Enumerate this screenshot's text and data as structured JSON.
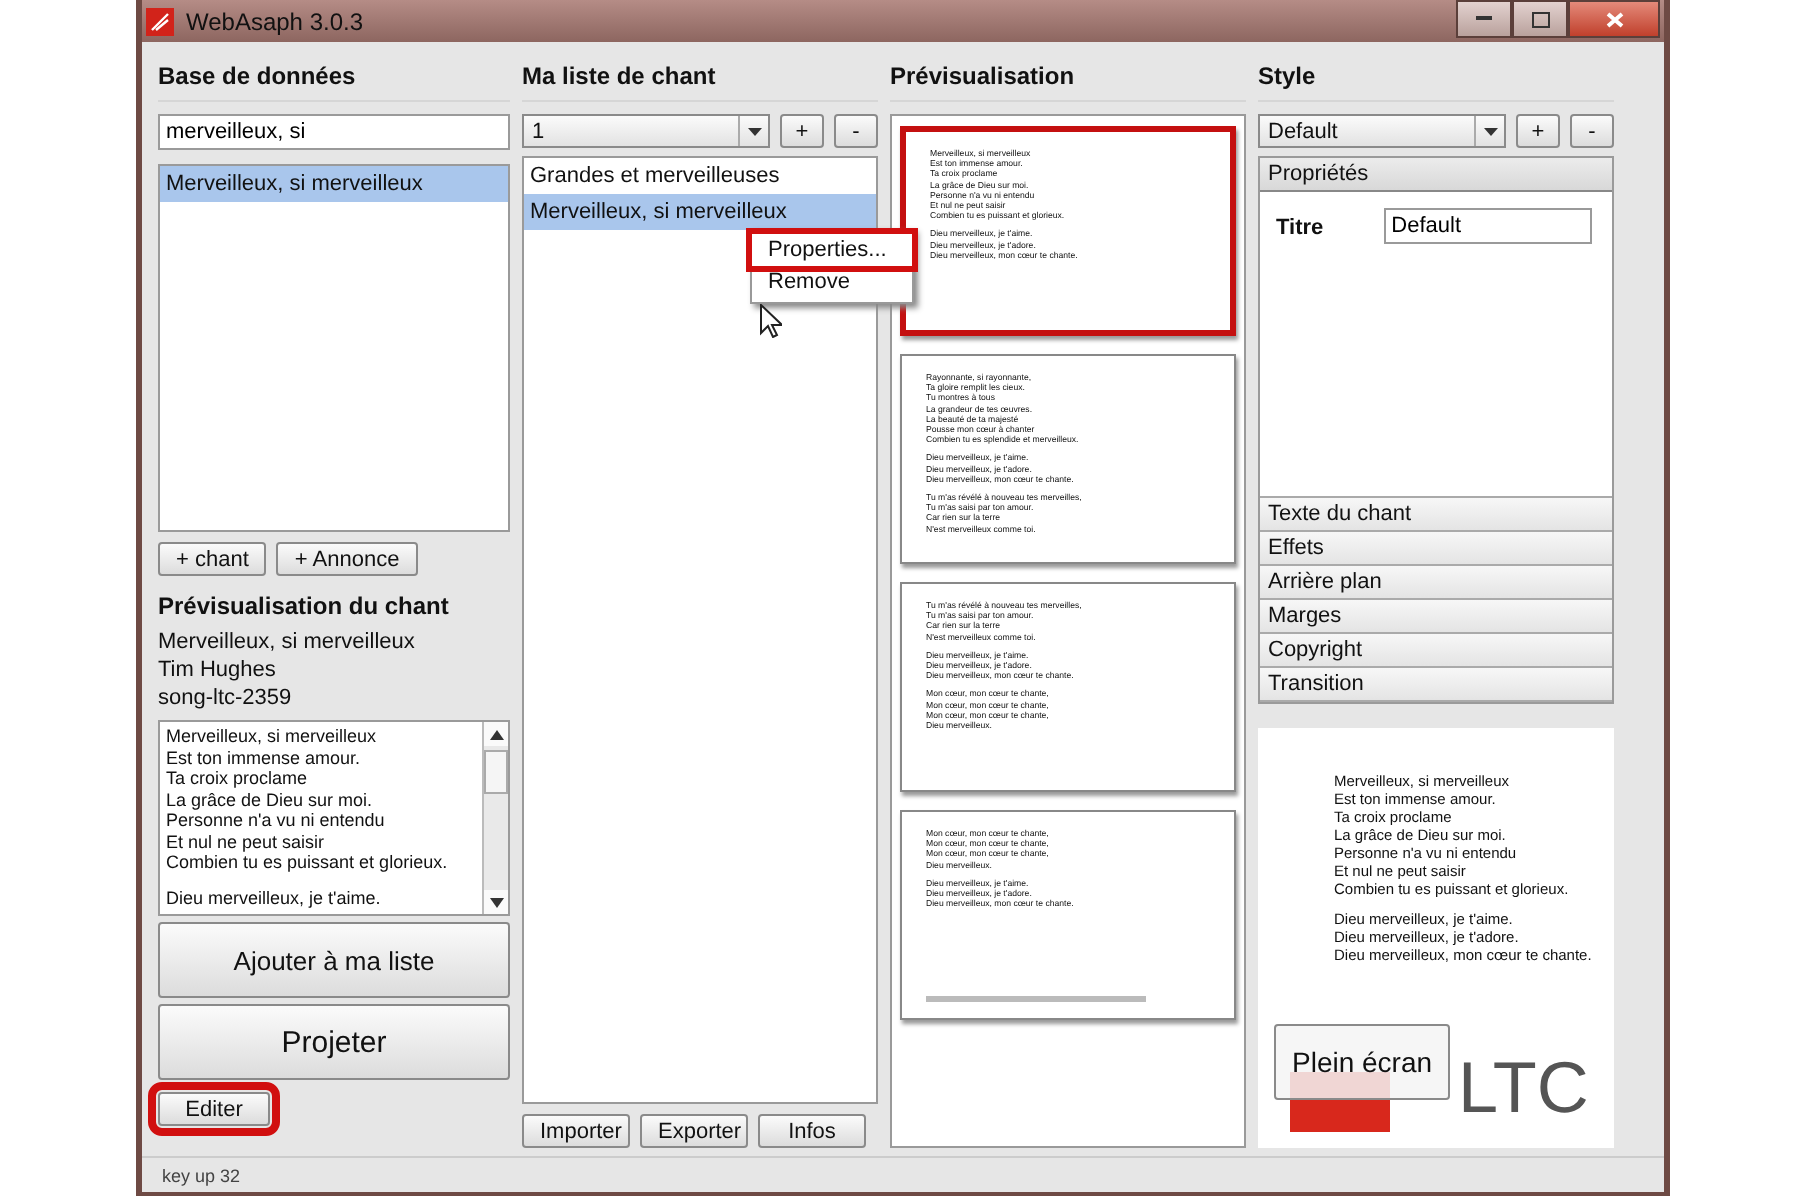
{
  "window": {
    "title": "WebAsaph 3.0.3"
  },
  "database": {
    "heading": "Base de données",
    "search": "merveilleux, si",
    "results": [
      {
        "label": "Merveilleux, si merveilleux",
        "selected": true
      }
    ],
    "buttons": [
      "+ chant",
      "+ Annonce"
    ],
    "preview_heading": "Prévisualisation du chant",
    "song": {
      "title": "Merveilleux, si merveilleux",
      "author": "Tim Hughes",
      "id": "song-ltc-2359"
    },
    "lyrics": [
      [
        "Merveilleux, si merveilleux",
        "Est ton immense amour.",
        "Ta croix proclame",
        "La grâce de Dieu sur moi.",
        "Personne n'a vu ni entendu",
        "Et nul ne peut saisir",
        "Combien tu es puissant et glorieux."
      ],
      [
        "Dieu merveilleux, je t'aime."
      ]
    ],
    "add_button": "Ajouter à ma liste",
    "project_button": "Projeter",
    "edit_button": {
      "label": "Editer",
      "highlighted": true
    }
  },
  "playlist": {
    "heading": "Ma liste de chant",
    "selector": "1",
    "add": "+",
    "remove": "-",
    "items": [
      {
        "label": "Grandes et merveilleuses",
        "selected": false
      },
      {
        "label": "Merveilleux, si merveilleux",
        "selected": true
      }
    ],
    "context_menu": {
      "items": [
        {
          "label": "Properties...",
          "highlighted": true
        },
        {
          "label": "Remove",
          "highlighted": false
        }
      ]
    },
    "buttons": [
      "Importer",
      "Exporter",
      "Infos"
    ]
  },
  "slides": {
    "heading": "Prévisualisation",
    "items": [
      {
        "selected": true,
        "stanzas": [
          [
            "Merveilleux, si merveilleux",
            "Est ton immense amour.",
            "Ta croix proclame",
            "La grâce de Dieu sur moi.",
            "Personne n'a vu ni entendu",
            "Et nul ne peut saisir",
            "Combien tu es puissant et glorieux."
          ],
          [
            "Dieu merveilleux, je t'aime.",
            "Dieu merveilleux, je t'adore.",
            "Dieu merveilleux, mon cœur te chante."
          ]
        ]
      },
      {
        "selected": false,
        "stanzas": [
          [
            "Rayonnante, si rayonnante,",
            "Ta gloire remplit les cieux.",
            "Tu montres à tous",
            "La grandeur de tes œuvres.",
            "La beauté de ta majesté",
            "Pousse mon cœur à chanter",
            "Combien tu es splendide et merveilleux."
          ],
          [
            "Dieu merveilleux, je t'aime.",
            "Dieu merveilleux, je t'adore.",
            "Dieu merveilleux, mon cœur te chante."
          ],
          [
            "Tu m'as révélé à nouveau tes merveilles,",
            "Tu m'as saisi par ton amour.",
            "Car rien sur la terre",
            "N'est merveilleux comme toi."
          ]
        ]
      },
      {
        "selected": false,
        "stanzas": [
          [
            "Tu m'as révélé à nouveau tes merveilles,",
            "Tu m'as saisi par ton amour.",
            "Car rien sur la terre",
            "N'est merveilleux comme toi."
          ],
          [
            "Dieu merveilleux, je t'aime.",
            "Dieu merveilleux, je t'adore.",
            "Dieu merveilleux, mon cœur te chante."
          ],
          [
            "Mon cœur, mon cœur te chante,",
            "Mon cœur, mon cœur te chante,",
            "Mon cœur, mon cœur te chante,",
            "Dieu merveilleux."
          ]
        ]
      },
      {
        "selected": false,
        "stanzas": [
          [
            "Mon cœur, mon cœur te chante,",
            "Mon cœur, mon cœur te chante,",
            "Mon cœur, mon cœur te chante,",
            "Dieu merveilleux."
          ],
          [
            "Dieu merveilleux, je t'aime.",
            "Dieu merveilleux, je t'adore.",
            "Dieu merveilleux, mon cœur te chante."
          ]
        ]
      }
    ]
  },
  "style": {
    "heading": "Style",
    "selector": "Default",
    "add": "+",
    "remove": "-",
    "sections": [
      {
        "label": "Propriétés",
        "expanded": true,
        "fields": [
          {
            "label": "Titre",
            "value": "Default"
          }
        ]
      },
      {
        "label": "Texte du chant",
        "expanded": false
      },
      {
        "label": "Effets",
        "expanded": false
      },
      {
        "label": "Arrière plan",
        "expanded": false
      },
      {
        "label": "Marges",
        "expanded": false
      },
      {
        "label": "Copyright",
        "expanded": false
      },
      {
        "label": "Transition",
        "expanded": false
      }
    ],
    "preview": [
      [
        "Merveilleux, si merveilleux",
        "Est ton immense amour.",
        "Ta croix proclame",
        "La grâce de Dieu sur moi.",
        "Personne n'a vu ni entendu",
        "Et nul ne peut saisir",
        "Combien tu es puissant et glorieux."
      ],
      [
        "Dieu merveilleux, je t'aime.",
        "Dieu merveilleux, je t'adore.",
        "Dieu merveilleux, mon cœur te chante."
      ]
    ],
    "fullscreen_button": "Plein écran",
    "logo": "LTC"
  },
  "status_bar": "key up 32"
}
